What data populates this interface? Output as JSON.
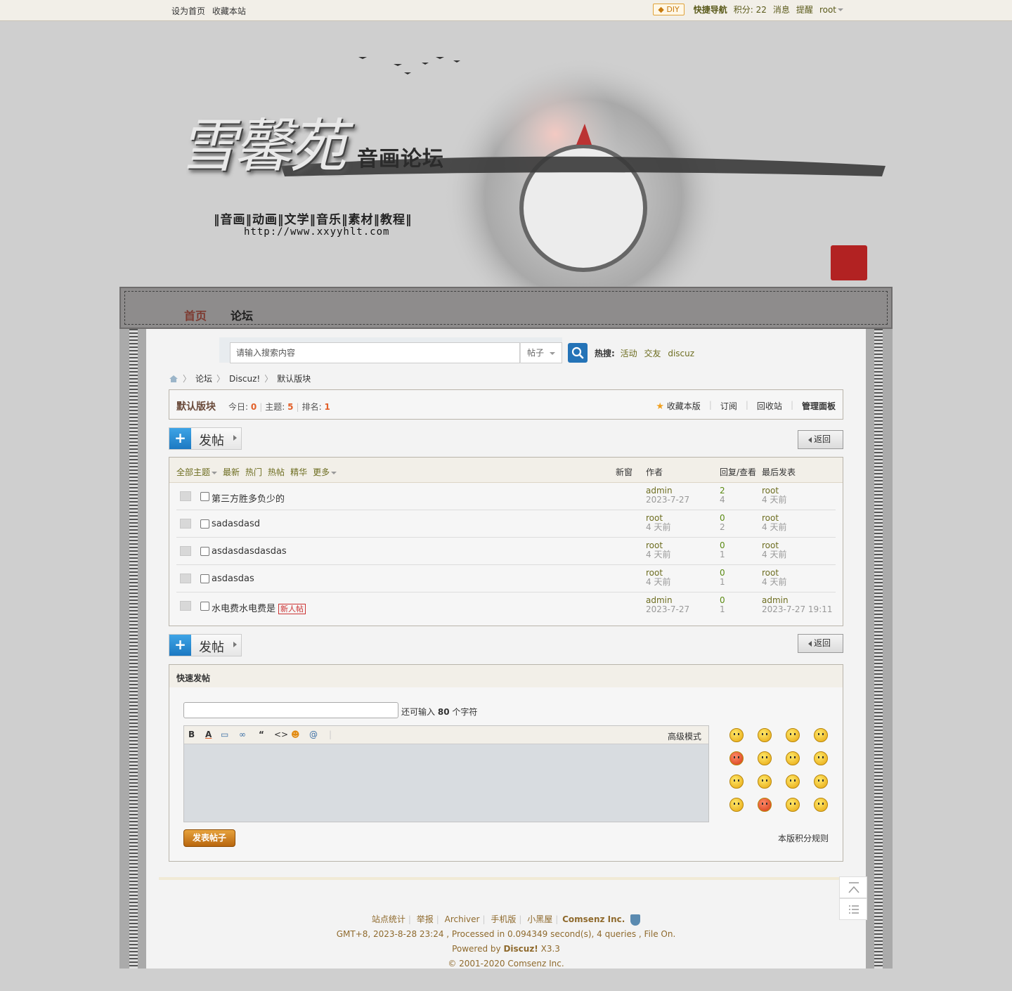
{
  "topbar": {
    "set_home": "设为首页",
    "bookmark": "收藏本站",
    "diy": "DIY",
    "quick_nav": "快捷导航",
    "points": "积分: 22",
    "messages": "消息",
    "reminders": "提醒",
    "user": "root"
  },
  "banner": {
    "brand": "雪馨苑",
    "subtitle": "音画论坛",
    "sections": "‖音画‖动画‖文学‖音乐‖素材‖教程‖",
    "url": "http://www.xxyyhlt.com"
  },
  "nav": {
    "home": "首页",
    "forum": "论坛"
  },
  "search": {
    "placeholder": "请输入搜索内容",
    "type": "帖子",
    "hot_label": "热搜:",
    "hot_terms": [
      "活动",
      "交友",
      "discuz"
    ]
  },
  "breadcrumb": [
    "论坛",
    "Discuz!",
    "默认版块"
  ],
  "forum": {
    "name": "默认版块",
    "today_label": "今日:",
    "today": "0",
    "topics_label": "主题:",
    "topics": "5",
    "rank_label": "排名:",
    "rank": "1",
    "actions": {
      "favorite": "收藏本版",
      "subscribe": "订阅",
      "recycle": "回收站",
      "manage": "管理面板"
    }
  },
  "buttons": {
    "post": "发帖",
    "back": "返回"
  },
  "threadlist": {
    "filters": [
      "全部主题",
      "最新",
      "热门",
      "热帖",
      "精华",
      "更多"
    ],
    "col_new": "新窗",
    "col_author": "作者",
    "col_replies": "回复/查看",
    "col_last": "最后发表",
    "rows": [
      {
        "title": "第三方胜多负少的",
        "author": "admin",
        "date": "2023-7-27",
        "replies": "2",
        "views": "4",
        "last_user": "root",
        "last_time": "4 天前",
        "tag": ""
      },
      {
        "title": "sadasdasd",
        "author": "root",
        "date": "4 天前",
        "replies": "0",
        "views": "2",
        "last_user": "root",
        "last_time": "4 天前",
        "tag": ""
      },
      {
        "title": "asdasdasdasdas",
        "author": "root",
        "date": "4 天前",
        "replies": "0",
        "views": "1",
        "last_user": "root",
        "last_time": "4 天前",
        "tag": ""
      },
      {
        "title": "asdasdas",
        "author": "root",
        "date": "4 天前",
        "replies": "0",
        "views": "1",
        "last_user": "root",
        "last_time": "4 天前",
        "tag": ""
      },
      {
        "title": "水电费水电费是",
        "author": "admin",
        "date": "2023-7-27",
        "replies": "0",
        "views": "1",
        "last_user": "admin",
        "last_time": "2023-7-27 19:11",
        "tag": "新人帖"
      }
    ]
  },
  "quickpost": {
    "title": "快速发帖",
    "remain_prefix": "还可输入",
    "remain_count": "80",
    "remain_suffix": "个字符",
    "advanced": "高级模式",
    "submit": "发表帖子",
    "rules": "本版积分规则",
    "toolbar": [
      "B",
      "A",
      "▭",
      "∞",
      "“",
      "<>",
      "☻",
      "@"
    ]
  },
  "footer": {
    "links": [
      "站点统计",
      "举报",
      "Archiver",
      "手机版",
      "小黑屋"
    ],
    "company": "Comsenz Inc.",
    "stats": "GMT+8, 2023-8-28 23:24 , Processed in 0.094349 second(s), 4 queries , File On.",
    "powered_prefix": "Powered by",
    "powered_name": "Discuz!",
    "powered_version": "X3.3",
    "copyright": "© 2001-2020 Comsenz Inc."
  }
}
